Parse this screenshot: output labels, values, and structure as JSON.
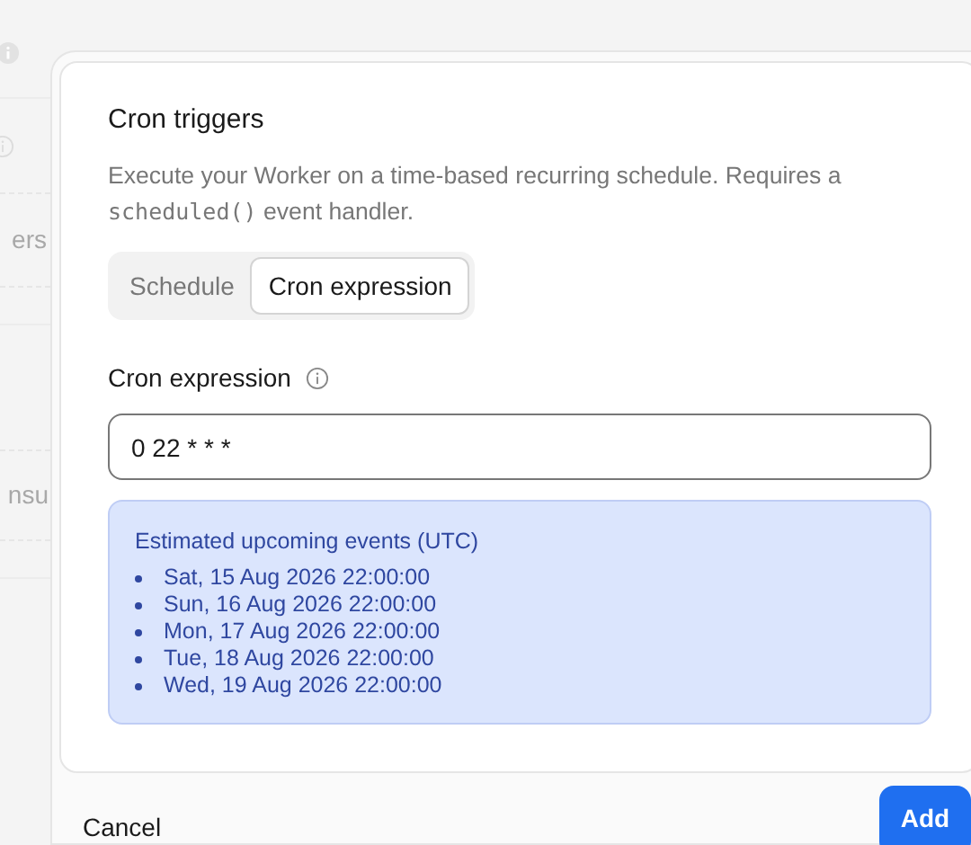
{
  "background": {
    "fragments": [
      "ers",
      "nsu"
    ]
  },
  "dialog": {
    "title": "Cron triggers",
    "description": "Execute your Worker on a time-based recurring schedule. Requires a",
    "code": "scheduled()",
    "description_end": "event handler.",
    "tabs": [
      {
        "label": "Schedule",
        "selected": false
      },
      {
        "label": "Cron expression",
        "selected": true
      }
    ],
    "field": {
      "label": "Cron expression",
      "value": "0 22 * * *"
    },
    "events": {
      "title": "Estimated upcoming events (UTC)",
      "items": [
        "Sat, 15 Aug 2026 22:00:00",
        "Sun, 16 Aug 2026 22:00:00",
        "Mon, 17 Aug 2026 22:00:00",
        "Tue, 18 Aug 2026 22:00:00",
        "Wed, 19 Aug 2026 22:00:00"
      ]
    },
    "buttons": [
      "Cancel",
      "Add"
    ]
  }
}
